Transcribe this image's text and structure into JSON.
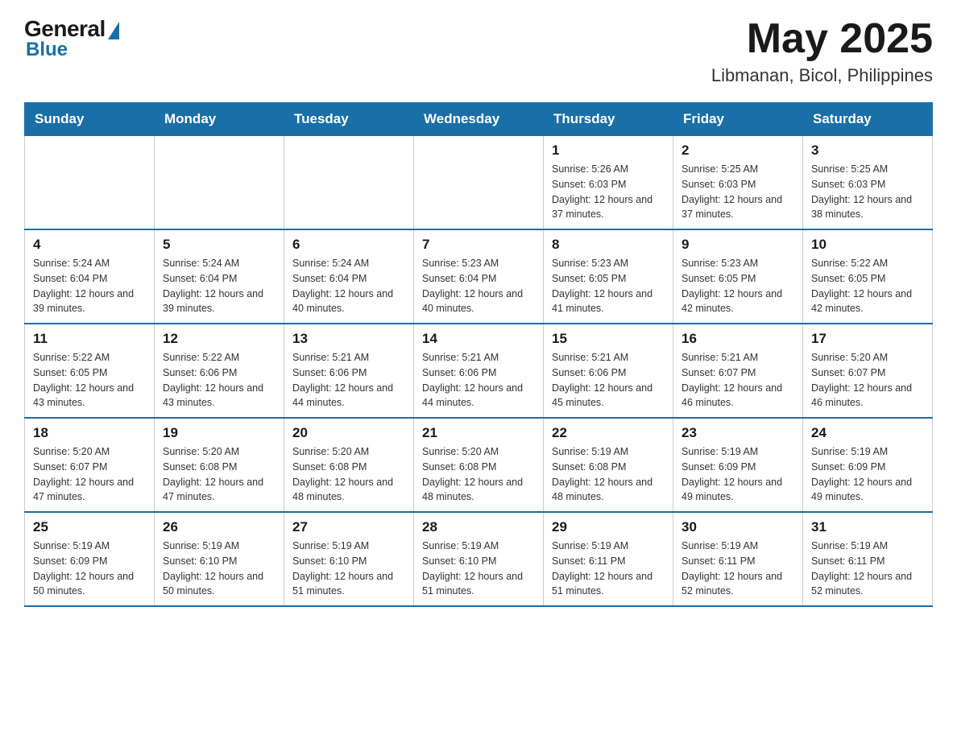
{
  "header": {
    "logo_general": "General",
    "logo_blue": "Blue",
    "month_title": "May 2025",
    "location": "Libmanan, Bicol, Philippines"
  },
  "days_of_week": [
    "Sunday",
    "Monday",
    "Tuesday",
    "Wednesday",
    "Thursday",
    "Friday",
    "Saturday"
  ],
  "weeks": [
    [
      {
        "num": "",
        "info": ""
      },
      {
        "num": "",
        "info": ""
      },
      {
        "num": "",
        "info": ""
      },
      {
        "num": "",
        "info": ""
      },
      {
        "num": "1",
        "info": "Sunrise: 5:26 AM\nSunset: 6:03 PM\nDaylight: 12 hours and 37 minutes."
      },
      {
        "num": "2",
        "info": "Sunrise: 5:25 AM\nSunset: 6:03 PM\nDaylight: 12 hours and 37 minutes."
      },
      {
        "num": "3",
        "info": "Sunrise: 5:25 AM\nSunset: 6:03 PM\nDaylight: 12 hours and 38 minutes."
      }
    ],
    [
      {
        "num": "4",
        "info": "Sunrise: 5:24 AM\nSunset: 6:04 PM\nDaylight: 12 hours and 39 minutes."
      },
      {
        "num": "5",
        "info": "Sunrise: 5:24 AM\nSunset: 6:04 PM\nDaylight: 12 hours and 39 minutes."
      },
      {
        "num": "6",
        "info": "Sunrise: 5:24 AM\nSunset: 6:04 PM\nDaylight: 12 hours and 40 minutes."
      },
      {
        "num": "7",
        "info": "Sunrise: 5:23 AM\nSunset: 6:04 PM\nDaylight: 12 hours and 40 minutes."
      },
      {
        "num": "8",
        "info": "Sunrise: 5:23 AM\nSunset: 6:05 PM\nDaylight: 12 hours and 41 minutes."
      },
      {
        "num": "9",
        "info": "Sunrise: 5:23 AM\nSunset: 6:05 PM\nDaylight: 12 hours and 42 minutes."
      },
      {
        "num": "10",
        "info": "Sunrise: 5:22 AM\nSunset: 6:05 PM\nDaylight: 12 hours and 42 minutes."
      }
    ],
    [
      {
        "num": "11",
        "info": "Sunrise: 5:22 AM\nSunset: 6:05 PM\nDaylight: 12 hours and 43 minutes."
      },
      {
        "num": "12",
        "info": "Sunrise: 5:22 AM\nSunset: 6:06 PM\nDaylight: 12 hours and 43 minutes."
      },
      {
        "num": "13",
        "info": "Sunrise: 5:21 AM\nSunset: 6:06 PM\nDaylight: 12 hours and 44 minutes."
      },
      {
        "num": "14",
        "info": "Sunrise: 5:21 AM\nSunset: 6:06 PM\nDaylight: 12 hours and 44 minutes."
      },
      {
        "num": "15",
        "info": "Sunrise: 5:21 AM\nSunset: 6:06 PM\nDaylight: 12 hours and 45 minutes."
      },
      {
        "num": "16",
        "info": "Sunrise: 5:21 AM\nSunset: 6:07 PM\nDaylight: 12 hours and 46 minutes."
      },
      {
        "num": "17",
        "info": "Sunrise: 5:20 AM\nSunset: 6:07 PM\nDaylight: 12 hours and 46 minutes."
      }
    ],
    [
      {
        "num": "18",
        "info": "Sunrise: 5:20 AM\nSunset: 6:07 PM\nDaylight: 12 hours and 47 minutes."
      },
      {
        "num": "19",
        "info": "Sunrise: 5:20 AM\nSunset: 6:08 PM\nDaylight: 12 hours and 47 minutes."
      },
      {
        "num": "20",
        "info": "Sunrise: 5:20 AM\nSunset: 6:08 PM\nDaylight: 12 hours and 48 minutes."
      },
      {
        "num": "21",
        "info": "Sunrise: 5:20 AM\nSunset: 6:08 PM\nDaylight: 12 hours and 48 minutes."
      },
      {
        "num": "22",
        "info": "Sunrise: 5:19 AM\nSunset: 6:08 PM\nDaylight: 12 hours and 48 minutes."
      },
      {
        "num": "23",
        "info": "Sunrise: 5:19 AM\nSunset: 6:09 PM\nDaylight: 12 hours and 49 minutes."
      },
      {
        "num": "24",
        "info": "Sunrise: 5:19 AM\nSunset: 6:09 PM\nDaylight: 12 hours and 49 minutes."
      }
    ],
    [
      {
        "num": "25",
        "info": "Sunrise: 5:19 AM\nSunset: 6:09 PM\nDaylight: 12 hours and 50 minutes."
      },
      {
        "num": "26",
        "info": "Sunrise: 5:19 AM\nSunset: 6:10 PM\nDaylight: 12 hours and 50 minutes."
      },
      {
        "num": "27",
        "info": "Sunrise: 5:19 AM\nSunset: 6:10 PM\nDaylight: 12 hours and 51 minutes."
      },
      {
        "num": "28",
        "info": "Sunrise: 5:19 AM\nSunset: 6:10 PM\nDaylight: 12 hours and 51 minutes."
      },
      {
        "num": "29",
        "info": "Sunrise: 5:19 AM\nSunset: 6:11 PM\nDaylight: 12 hours and 51 minutes."
      },
      {
        "num": "30",
        "info": "Sunrise: 5:19 AM\nSunset: 6:11 PM\nDaylight: 12 hours and 52 minutes."
      },
      {
        "num": "31",
        "info": "Sunrise: 5:19 AM\nSunset: 6:11 PM\nDaylight: 12 hours and 52 minutes."
      }
    ]
  ]
}
